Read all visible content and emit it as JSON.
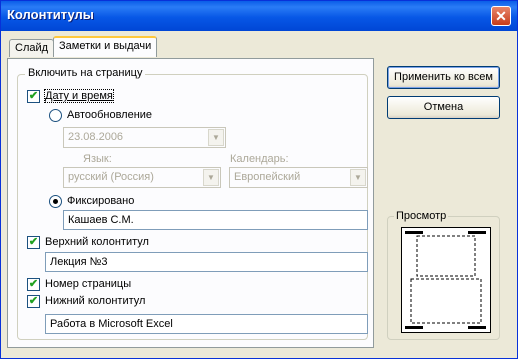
{
  "window": {
    "title": "Колонтитулы",
    "close_glyph": "✕"
  },
  "tabs": [
    {
      "label": "Слайд",
      "active": false
    },
    {
      "label": "Заметки и выдачи",
      "active": true
    }
  ],
  "include_group": {
    "label": "Включить на страницу",
    "date_time": {
      "label": "Дату и время",
      "checked": true,
      "auto_update": {
        "label": "Автообновление",
        "selected": false,
        "date_value": "23.08.2006",
        "language_label": "Язык:",
        "language_value": "русский (Россия)",
        "calendar_label": "Календарь:",
        "calendar_value": "Европейский"
      },
      "fixed": {
        "label": "Фиксировано",
        "selected": true,
        "value": "Кашаев С.М."
      }
    },
    "header": {
      "label": "Верхний колонтитул",
      "checked": true,
      "value": "Лекция №3"
    },
    "page_number": {
      "label": "Номер страницы",
      "checked": true
    },
    "footer": {
      "label": "Нижний колонтитул",
      "checked": true,
      "value": "Работа в Microsoft Excel"
    }
  },
  "buttons": {
    "apply_all": "Применить ко всем",
    "cancel": "Отмена"
  },
  "preview": {
    "label": "Просмотр"
  },
  "icons": {
    "check": "✔",
    "dropdown": "▼"
  },
  "colors": {
    "titlebar": "#0a5de8",
    "dialog_bg": "#ece9d8",
    "check": "#21a121"
  }
}
